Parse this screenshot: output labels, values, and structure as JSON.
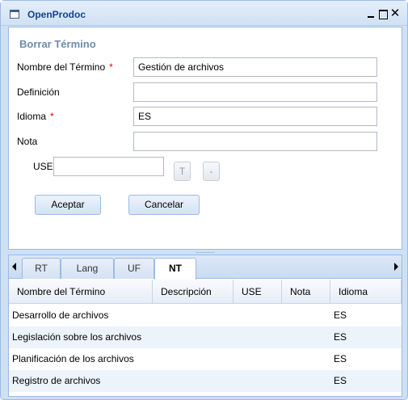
{
  "window": {
    "title": "OpenProdoc"
  },
  "form": {
    "title": "Borrar Término",
    "fields": [
      {
        "label": "Nombre del Término",
        "required": true,
        "value": "Gestión de archivos"
      },
      {
        "label": "Definición",
        "required": false,
        "value": ""
      },
      {
        "label": "Idioma",
        "required": true,
        "value": "ES"
      },
      {
        "label": "Nota",
        "required": false,
        "value": ""
      }
    ],
    "required_mark": "*",
    "use": {
      "label": "USE",
      "value": "",
      "btn_t": "T",
      "btn_minus": "-"
    },
    "accept_label": "Aceptar",
    "cancel_label": "Cancelar"
  },
  "tabs": [
    {
      "label": "RT",
      "active": false
    },
    {
      "label": "Lang",
      "active": false
    },
    {
      "label": "UF",
      "active": false
    },
    {
      "label": "NT",
      "active": true
    }
  ],
  "grid": {
    "columns": [
      "Nombre del Término",
      "Descripción",
      "USE",
      "Nota",
      "Idioma"
    ],
    "rows": [
      [
        "Desarrollo de archivos",
        "",
        "",
        "",
        "ES"
      ],
      [
        "Legislación sobre los archivos",
        "",
        "",
        "",
        "ES"
      ],
      [
        "Planificación de los archivos",
        "",
        "",
        "",
        "ES"
      ],
      [
        "Registro de archivos",
        "",
        "",
        "",
        "ES"
      ]
    ]
  }
}
